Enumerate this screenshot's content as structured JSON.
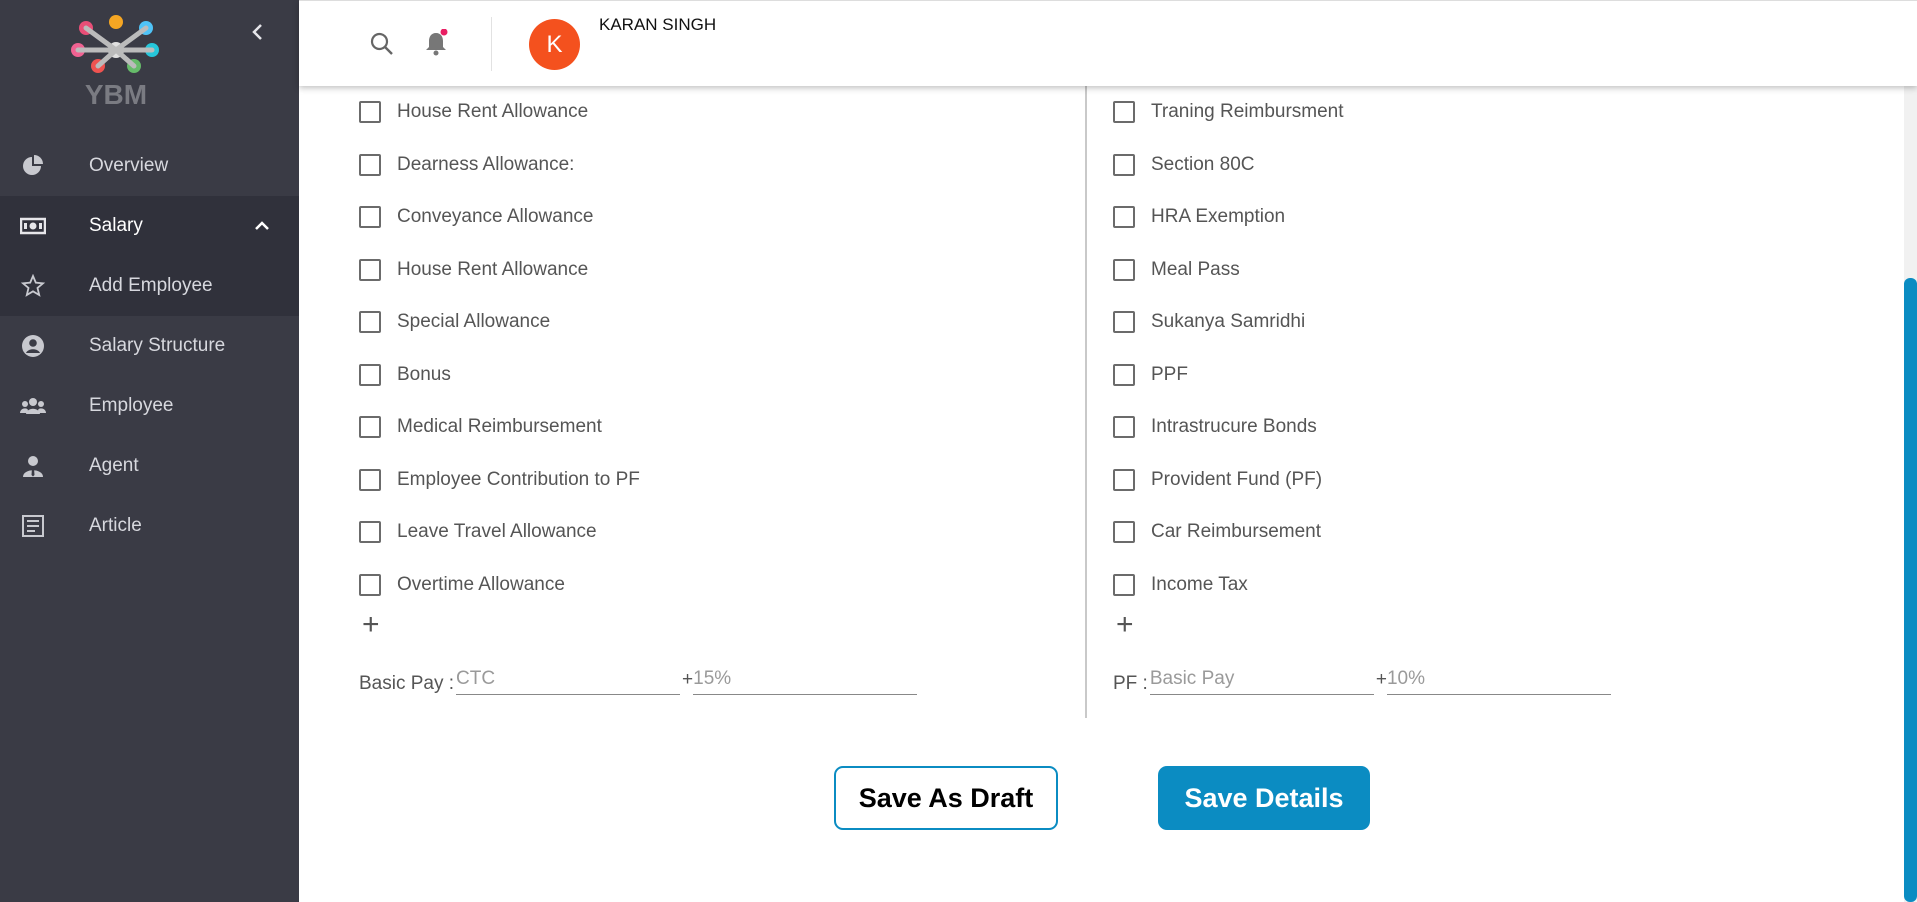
{
  "sidebar": {
    "brand": "YBM",
    "items": [
      {
        "label": "Overview",
        "icon": "pie-chart-icon"
      },
      {
        "label": "Salary",
        "icon": "money-icon"
      },
      {
        "label": "Add Employee",
        "icon": "star-icon"
      },
      {
        "label": "Salary Structure",
        "icon": "user-circle-icon"
      },
      {
        "label": "Employee",
        "icon": "group-icon"
      },
      {
        "label": "Agent",
        "icon": "agent-icon"
      },
      {
        "label": "Article",
        "icon": "article-icon"
      }
    ]
  },
  "header": {
    "avatar_initial": "K",
    "user_name": "KARAN SINGH"
  },
  "left_column": {
    "items": [
      "House Rent Allowance",
      "Dearness Allowance:",
      "Conveyance Allowance",
      "House Rent Allowance",
      "Special Allowance",
      "Bonus",
      "Medical Reimbursement",
      "Employee Contribution to PF",
      "Leave Travel Allowance",
      "Overtime Allowance"
    ],
    "formula": {
      "label": "Basic Pay :",
      "field1_placeholder": "CTC",
      "operator": "+",
      "field2_placeholder": "15%"
    }
  },
  "right_column": {
    "items": [
      "Traning Reimbursment",
      "Section 80C",
      "HRA Exemption",
      "Meal Pass",
      "Sukanya Samridhi",
      "PPF",
      "Intrastrucure Bonds",
      "Provident Fund (PF)",
      "Car Reimbursement",
      "Income Tax"
    ],
    "formula": {
      "label": "PF :",
      "field1_placeholder": "Basic Pay",
      "operator": "+",
      "field2_placeholder": "10%"
    }
  },
  "actions": {
    "draft_label": "Save As Draft",
    "save_label": "Save Details"
  },
  "colors": {
    "sidebar_bg": "#3a3b45",
    "accent": "#0b8cc2",
    "avatar": "#f4511e"
  }
}
